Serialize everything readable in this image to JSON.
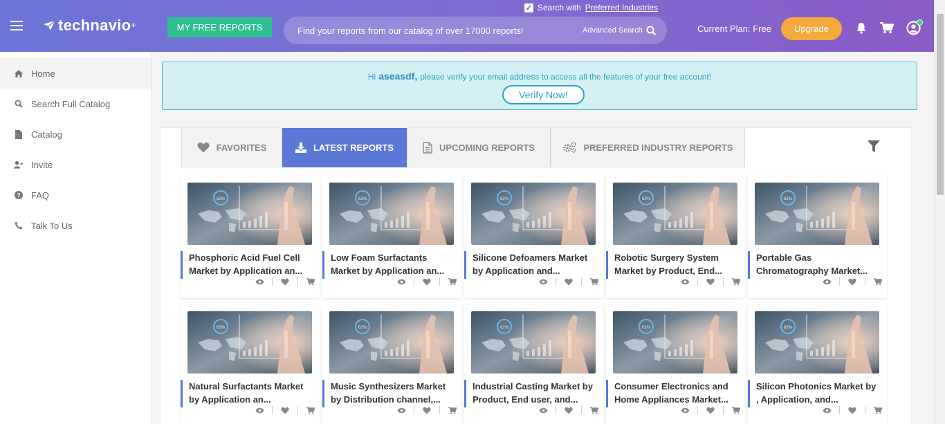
{
  "header": {
    "logo_text": "technavio",
    "logo_tm": "®",
    "free_reports_label": "MY FREE REPORTS",
    "preferred_check_label": "Search with",
    "preferred_link": "Preferred Industries",
    "search_placeholder": "Find your reports from our catalog of over 17000 reports!",
    "advanced_search": "Advanced Search",
    "current_plan": "Current Plan: Free",
    "upgrade_label": "Upgrade"
  },
  "sidebar": {
    "items": [
      {
        "label": "Home",
        "icon": "home-icon"
      },
      {
        "label": "Search Full Catalog",
        "icon": "search-icon"
      },
      {
        "label": "Catalog",
        "icon": "file-icon"
      },
      {
        "label": "Invite",
        "icon": "user-plus-icon"
      },
      {
        "label": "FAQ",
        "icon": "question-icon"
      },
      {
        "label": "Talk To Us",
        "icon": "phone-icon"
      }
    ]
  },
  "alert": {
    "hi": "Hi",
    "username": "aseasdf,",
    "message": "please verify your email address to access all the features of your free account!",
    "verify_label": "Verify Now!"
  },
  "tabs": [
    {
      "label": "FAVORITES",
      "icon": "heart-icon"
    },
    {
      "label": "LATEST REPORTS",
      "icon": "download-icon"
    },
    {
      "label": "UPCOMING REPORTS",
      "icon": "document-icon"
    },
    {
      "label": "PREFERRED INDUSTRY REPORTS",
      "icon": "gears-icon"
    }
  ],
  "reports": [
    {
      "title": "Phosphoric Acid Fuel Cell Market by Application an..."
    },
    {
      "title": "Low Foam Surfactants Market by Application an..."
    },
    {
      "title": "Silicone Defoamers Market by Application and..."
    },
    {
      "title": "Robotic Surgery System Market by Product, End..."
    },
    {
      "title": "Portable Gas Chromatography Market..."
    },
    {
      "title": "Natural Surfactants Market by Application an..."
    },
    {
      "title": "Music Synthesizers Market by Distribution channel,..."
    },
    {
      "title": "Industrial Casting Market by Product, End user, and..."
    },
    {
      "title": "Consumer Electronics and Home Appliances Market..."
    },
    {
      "title": "Silicon Photonics Market by , Application, and..."
    }
  ]
}
